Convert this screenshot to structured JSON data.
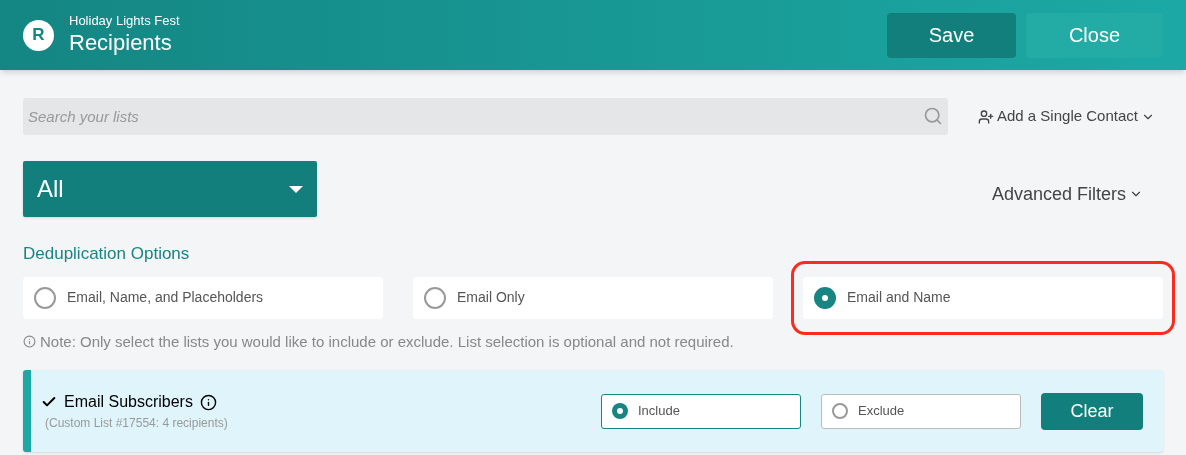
{
  "header": {
    "logo": "R",
    "event": "Holiday Lights Fest",
    "title": "Recipients",
    "buttons": [
      {
        "label": "Save",
        "kind": "primary"
      },
      {
        "label": "Close",
        "kind": "secondary"
      }
    ]
  },
  "search": {
    "placeholder": "Search your lists"
  },
  "add_contact": {
    "label": "Add a Single Contact"
  },
  "list_filter": {
    "value": "All"
  },
  "advanced_filters": {
    "label": "Advanced Filters"
  },
  "dedup": {
    "heading": "Deduplication Options",
    "options": [
      {
        "label": "Email, Name, and Placeholders",
        "selected": false,
        "highlighted": false
      },
      {
        "label": "Email Only",
        "selected": false,
        "highlighted": false
      },
      {
        "label": "Email and Name",
        "selected": true,
        "highlighted": true
      }
    ]
  },
  "note": "Note: Only select the lists you would like to include or exclude. List selection is optional and not required.",
  "lists": [
    {
      "name": "Email Subscribers",
      "checked": true,
      "details": "(Custom List #17554: 4 recipients)",
      "options": [
        {
          "label": "Include",
          "selected": true
        },
        {
          "label": "Exclude",
          "selected": false
        }
      ],
      "clear": "Clear"
    }
  ]
}
